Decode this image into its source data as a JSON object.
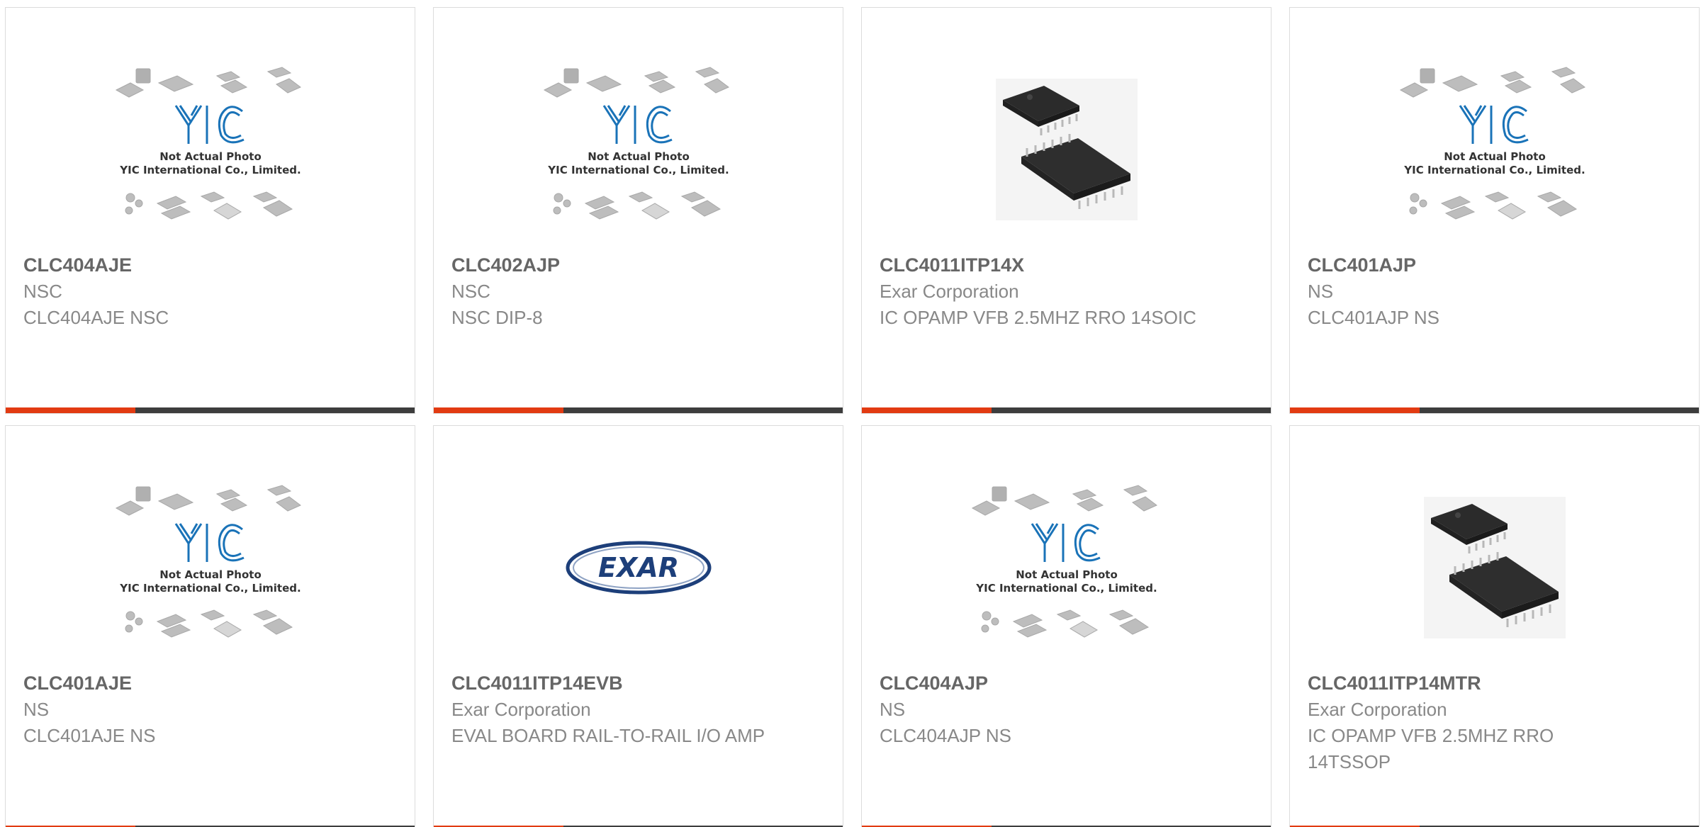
{
  "colors": {
    "accent_bar": "#e23b12",
    "dark_bar": "#3d3d3d",
    "card_border": "#dcdcdc",
    "part_text": "#666666",
    "meta_text": "#888888",
    "yic_blue": "#1a73b8",
    "exar_navy": "#1d3f7a"
  },
  "placeholder": {
    "line1": "Not Actual Photo",
    "line2": "YIC International Co., Limited.",
    "logo_text": "YIC"
  },
  "exar_logo": {
    "text": "EXAR"
  },
  "products": [
    {
      "part_number": "CLC404AJE",
      "manufacturer": "NSC",
      "description": "CLC404AJE NSC",
      "image": "placeholder"
    },
    {
      "part_number": "CLC402AJP",
      "manufacturer": "NSC",
      "description": "NSC DIP-8",
      "image": "placeholder"
    },
    {
      "part_number": "CLC4011ITP14X",
      "manufacturer": "Exar Corporation",
      "description": "IC OPAMP VFB 2.5MHZ RRO 14SOIC",
      "image": "chip-photo"
    },
    {
      "part_number": "CLC401AJP",
      "manufacturer": "NS",
      "description": "CLC401AJP NS",
      "image": "placeholder"
    },
    {
      "part_number": "CLC401AJE",
      "manufacturer": "NS",
      "description": "CLC401AJE NS",
      "image": "placeholder"
    },
    {
      "part_number": "CLC4011ITP14EVB",
      "manufacturer": "Exar Corporation",
      "description": "EVAL BOARD RAIL-TO-RAIL I/O AMP",
      "image": "exar-logo"
    },
    {
      "part_number": "CLC404AJP",
      "manufacturer": "NS",
      "description": "CLC404AJP NS",
      "image": "placeholder"
    },
    {
      "part_number": "CLC4011ITP14MTR",
      "manufacturer": "Exar Corporation",
      "description": "IC OPAMP VFB 2.5MHZ RRO 14TSSOP",
      "image": "chip-photo"
    }
  ]
}
